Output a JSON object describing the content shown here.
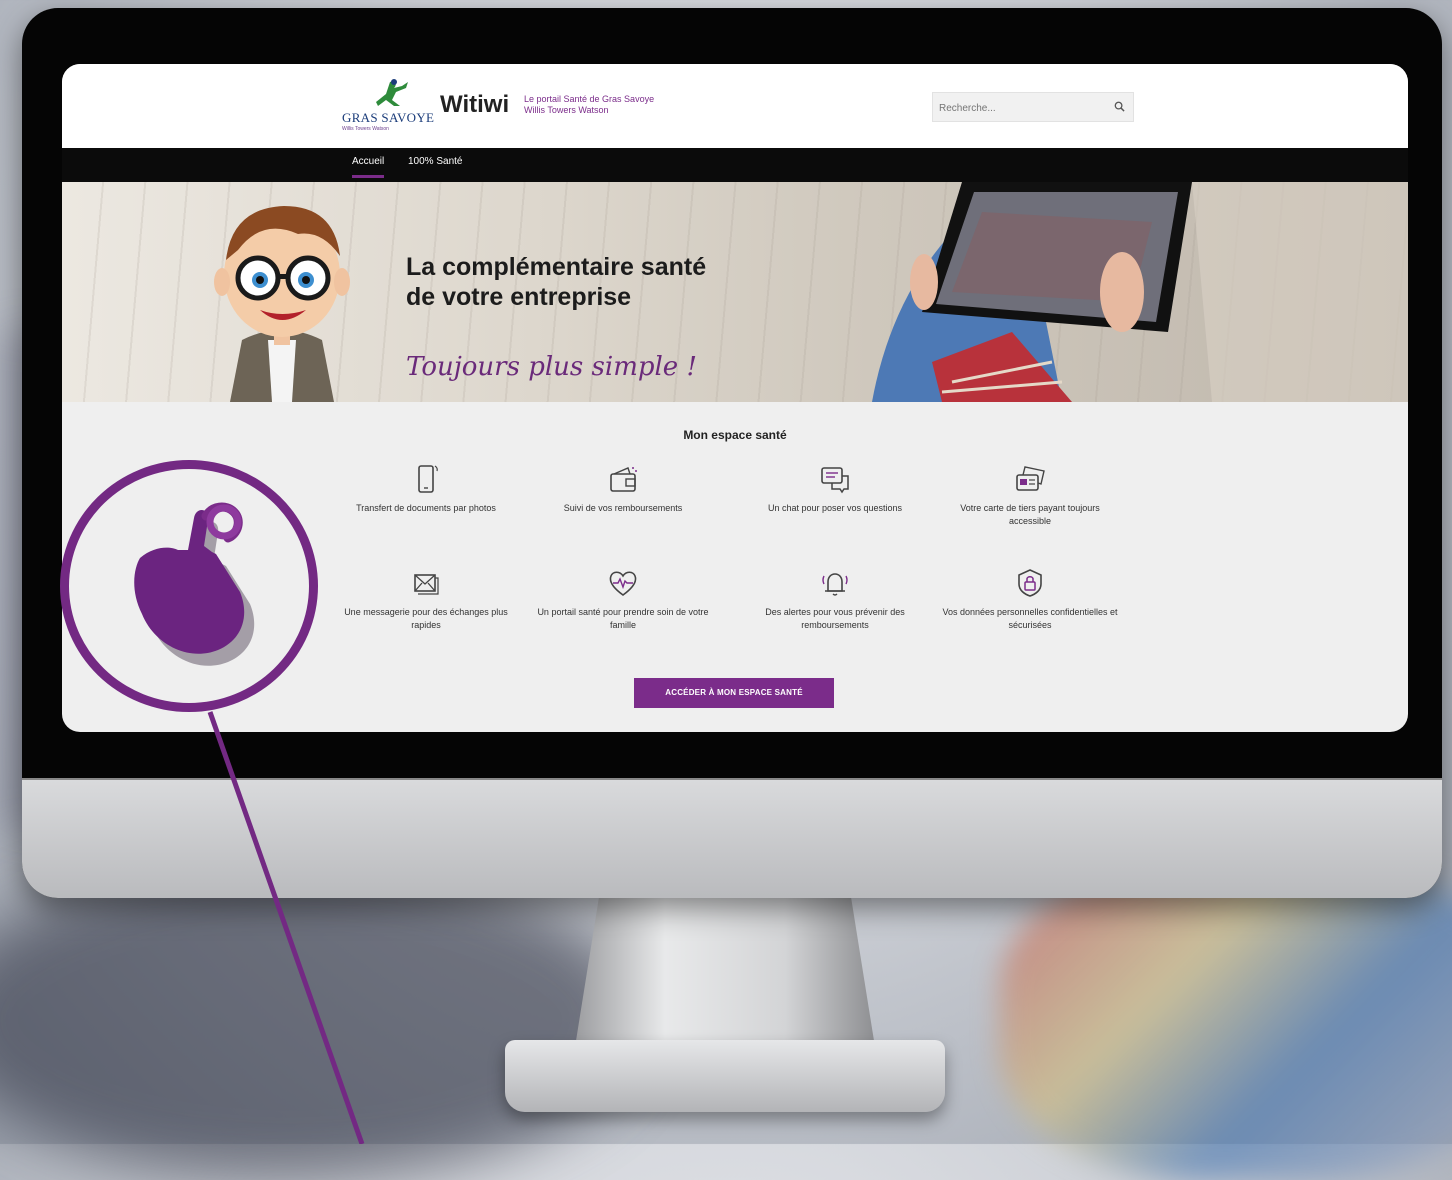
{
  "header": {
    "logo_text": "GRAS SAVOYE",
    "logo_subtext": "Willis Towers Watson",
    "brand": "Witiwi",
    "tagline_line1": "Le portail Santé de Gras Savoye",
    "tagline_line2": "Willis Towers Watson",
    "search_placeholder": "Recherche..."
  },
  "nav": {
    "items": [
      {
        "label": "Accueil",
        "active": true
      },
      {
        "label": "100% Santé",
        "active": false
      }
    ]
  },
  "hero": {
    "title_line1": "La complémentaire santé",
    "title_line2": "de votre entreprise",
    "script": "Toujours plus simple !"
  },
  "espace": {
    "title": "Mon espace santé",
    "features": [
      {
        "label": "Transfert de documents par photos",
        "icon": "phone-icon"
      },
      {
        "label": "Suivi de vos remboursements",
        "icon": "wallet-icon"
      },
      {
        "label": "Un chat pour poser vos questions",
        "icon": "chat-icon"
      },
      {
        "label": "Votre carte de tiers payant toujours accessible",
        "icon": "card-icon"
      },
      {
        "label": "Une messagerie pour des échanges plus rapides",
        "icon": "mail-icon"
      },
      {
        "label": "Un portail santé pour prendre soin de votre famille",
        "icon": "heart-icon"
      },
      {
        "label": "Des alertes pour vous prévenir des remboursements",
        "icon": "bell-icon"
      },
      {
        "label": "Vos données personnelles confidentielles et sécurisées",
        "icon": "lock-icon"
      }
    ],
    "cta": "ACCÉDER À MON ESPACE SANTÉ"
  },
  "colors": {
    "accent": "#7b2c8a",
    "nav_bg": "#0b0b0b"
  }
}
